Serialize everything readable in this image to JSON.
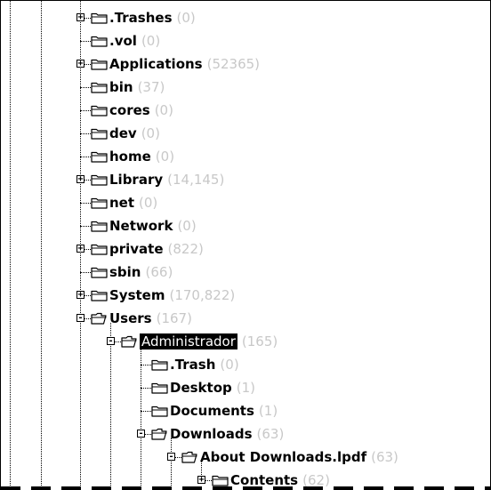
{
  "tree": {
    "nodes": [
      {
        "label": ".Trashes",
        "count": "(0)",
        "depth": 0,
        "expander": "+",
        "selected": false
      },
      {
        "label": ".vol",
        "count": "(0)",
        "depth": 0,
        "expander": "",
        "selected": false
      },
      {
        "label": "Applications",
        "count": "(52365)",
        "depth": 0,
        "expander": "+",
        "selected": false
      },
      {
        "label": "bin",
        "count": "(37)",
        "depth": 0,
        "expander": "",
        "selected": false
      },
      {
        "label": "cores",
        "count": "(0)",
        "depth": 0,
        "expander": "",
        "selected": false
      },
      {
        "label": "dev",
        "count": "(0)",
        "depth": 0,
        "expander": "",
        "selected": false
      },
      {
        "label": "home",
        "count": "(0)",
        "depth": 0,
        "expander": "",
        "selected": false
      },
      {
        "label": "Library",
        "count": "(14,145)",
        "depth": 0,
        "expander": "+",
        "selected": false
      },
      {
        "label": "net",
        "count": "(0)",
        "depth": 0,
        "expander": "",
        "selected": false
      },
      {
        "label": "Network",
        "count": "(0)",
        "depth": 0,
        "expander": "",
        "selected": false
      },
      {
        "label": "private",
        "count": "(822)",
        "depth": 0,
        "expander": "+",
        "selected": false
      },
      {
        "label": "sbin",
        "count": "(66)",
        "depth": 0,
        "expander": "",
        "selected": false
      },
      {
        "label": "System",
        "count": "(170,822)",
        "depth": 0,
        "expander": "+",
        "selected": false
      },
      {
        "label": "Users",
        "count": "(167)",
        "depth": 0,
        "expander": "-",
        "selected": false
      },
      {
        "label": "Administrador",
        "count": "(165)",
        "depth": 1,
        "expander": "-",
        "selected": true
      },
      {
        "label": ".Trash",
        "count": "(0)",
        "depth": 2,
        "expander": "",
        "selected": false
      },
      {
        "label": "Desktop",
        "count": "(1)",
        "depth": 2,
        "expander": "",
        "selected": false
      },
      {
        "label": "Documents",
        "count": "(1)",
        "depth": 2,
        "expander": "",
        "selected": false
      },
      {
        "label": "Downloads",
        "count": "(63)",
        "depth": 2,
        "expander": "-",
        "selected": false
      },
      {
        "label": "About Downloads.lpdf",
        "count": "(63)",
        "depth": 3,
        "expander": "-",
        "selected": false
      },
      {
        "label": "Contents",
        "count": "(62)",
        "depth": 4,
        "expander": "+",
        "selected": false
      }
    ]
  }
}
